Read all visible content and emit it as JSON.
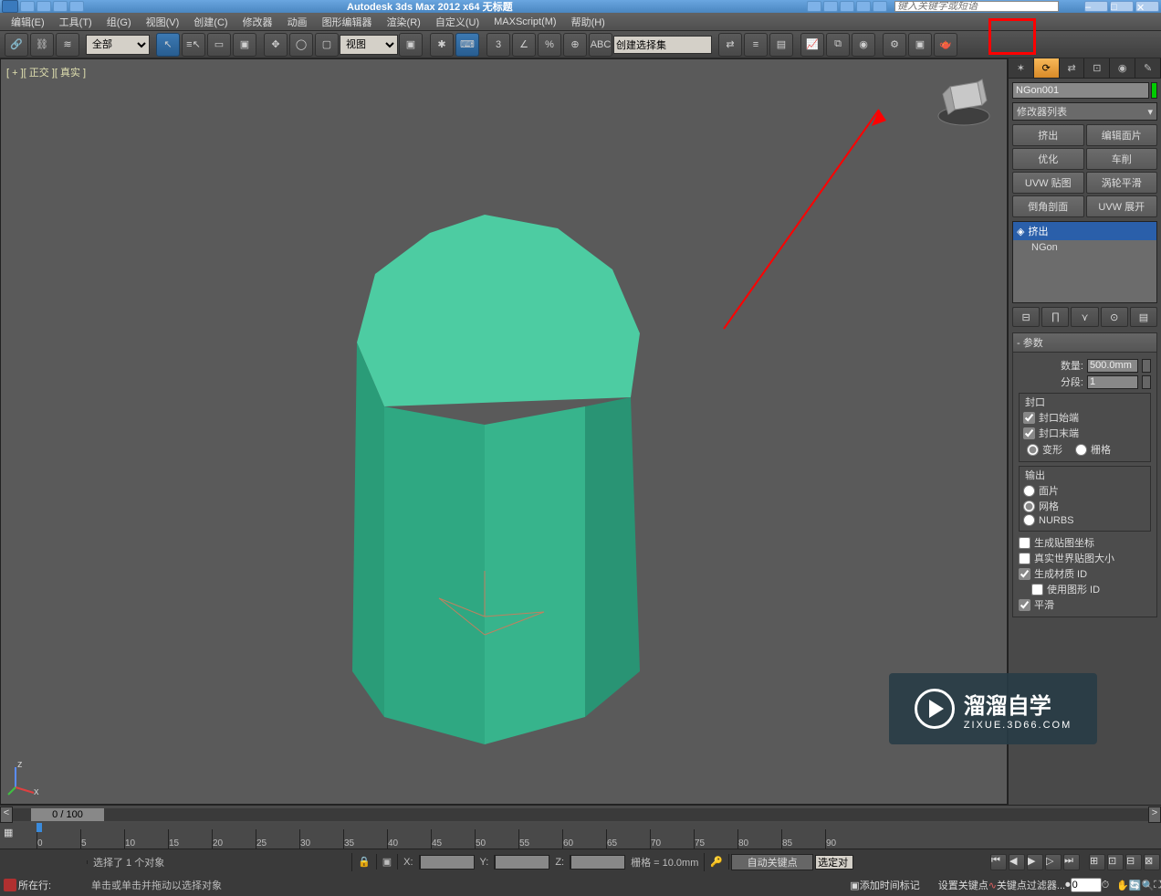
{
  "title": "Autodesk 3ds Max  2012 x64   无标题",
  "search_placeholder": "键入关键字或短语",
  "menus": [
    "编辑(E)",
    "工具(T)",
    "组(G)",
    "视图(V)",
    "创建(C)",
    "修改器",
    "动画",
    "图形编辑器",
    "渲染(R)",
    "自定义(U)",
    "MAXScript(M)",
    "帮助(H)"
  ],
  "toolbar": {
    "filter_dd": "全部",
    "view_dd": "视图",
    "named_set_dd": "创建选择集",
    "snap_label": "3",
    "angle_snap": "∠",
    "percent": "%"
  },
  "viewport_label": "[ + ][ 正交 ][ 真实 ]",
  "cmdpanel": {
    "tabs_icons": [
      "✶",
      "⟳",
      "⇄",
      "⊡",
      "◉",
      "✎"
    ],
    "objname": "NGon001",
    "modlist_dd": "修改器列表",
    "mod_buttons": [
      "挤出",
      "编辑面片",
      "优化",
      "车削",
      "UVW 贴图",
      "涡轮平滑",
      "倒角剖面",
      "UVW 展开"
    ],
    "stack": [
      {
        "icon": "◈",
        "label": "挤出",
        "selected": true
      },
      {
        "icon": "",
        "label": "NGon",
        "selected": false
      }
    ],
    "stacktools": [
      "⊟",
      "∏",
      "⋎",
      "⊙",
      "▤"
    ],
    "rollout_title": "-           参数",
    "params": {
      "amount_lbl": "数量:",
      "amount_val": "500.0mm",
      "segs_lbl": "分段:",
      "segs_val": "1"
    },
    "cap": {
      "legend": "封口",
      "start": "封口始端",
      "start_checked": true,
      "end": "封口末端",
      "end_checked": true,
      "morph": "变形",
      "grid": "栅格",
      "sel": "morph"
    },
    "output": {
      "legend": "输出",
      "patch": "面片",
      "mesh": "网格",
      "nurbs": "NURBS",
      "sel": "mesh"
    },
    "opts": {
      "genmap": "生成贴图坐标",
      "genmap_checked": false,
      "realworld": "真实世界贴图大小",
      "realworld_checked": false,
      "matid": "生成材质 ID",
      "matid_checked": true,
      "shapeid": "使用图形 ID",
      "shapeid_checked": false,
      "smooth": "平滑",
      "smooth_checked": true
    }
  },
  "time": {
    "slider": "0 / 100",
    "ticks": [
      0,
      5,
      10,
      15,
      20,
      25,
      30,
      35,
      40,
      45,
      50,
      55,
      60,
      65,
      70,
      75,
      80,
      85,
      90
    ]
  },
  "status": {
    "sel": "选择了 1 个对象",
    "xlab": "X:",
    "ylab": "Y:",
    "zlab": "Z:",
    "grid": "栅格 = 10.0mm",
    "autokey": "自动关键点",
    "seldd": "选定对",
    "setkey": "设置关键点",
    "keyfilter": "关键点过滤器...",
    "frame": "0",
    "addtag": "添加时间标记",
    "now_line": "所在行:",
    "hint": "单击或单击并拖动以选择对象"
  },
  "watermark": {
    "main": "溜溜自学",
    "sub": "ZIXUE.3D66.COM"
  },
  "window_buttons": [
    "–",
    "□",
    "✕"
  ]
}
